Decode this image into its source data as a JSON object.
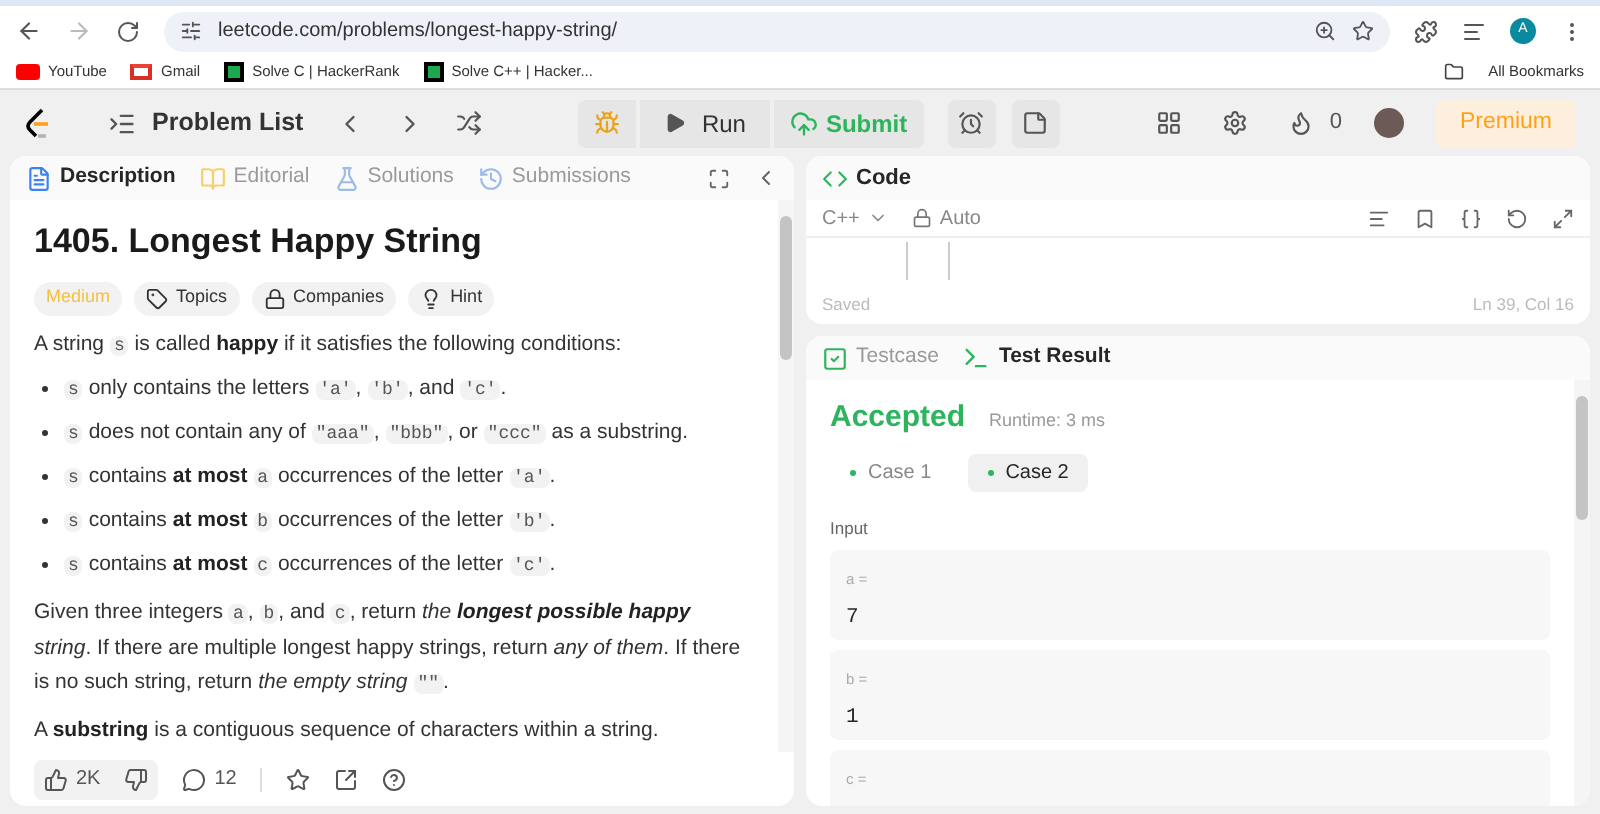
{
  "browser": {
    "url": "leetcode.com/problems/longest-happy-string/",
    "profile": "A",
    "bookmarks": [
      {
        "label": "YouTube",
        "kind": "youtube"
      },
      {
        "label": "Gmail",
        "kind": "gmail"
      },
      {
        "label": "Solve C | HackerRank",
        "kind": "hackerrank"
      },
      {
        "label": "Solve C++ | Hacker...",
        "kind": "hackerrank"
      }
    ],
    "all_bookmarks": "All Bookmarks"
  },
  "nav": {
    "problem_list": "Problem List",
    "run": "Run",
    "submit": "Submit",
    "streak": "0",
    "premium": "Premium"
  },
  "description_panel": {
    "tabs": [
      {
        "label": "Description",
        "selected": true,
        "kind": "description"
      },
      {
        "label": "Editorial",
        "selected": false,
        "kind": "editorial"
      },
      {
        "label": "Solutions",
        "selected": false,
        "kind": "solutions"
      },
      {
        "label": "Submissions",
        "selected": false,
        "kind": "submissions"
      }
    ],
    "title": "1405. Longest Happy String",
    "tags": [
      {
        "label": "Medium",
        "kind": "difficulty"
      },
      {
        "label": "Topics",
        "kind": "topics"
      },
      {
        "label": "Companies",
        "kind": "companies"
      },
      {
        "label": "Hint",
        "kind": "hint"
      }
    ],
    "blocks": [
      {
        "kind": "paragraph",
        "segments": [
          {
            "kind": "text",
            "text": "A string "
          },
          {
            "kind": "code",
            "text": "s"
          },
          {
            "kind": "text",
            "text": " is called "
          },
          {
            "kind": "bold",
            "text": "happy"
          },
          {
            "kind": "text",
            "text": " if it satisfies the following conditions:"
          }
        ]
      },
      {
        "kind": "bullet",
        "segments": [
          {
            "kind": "code",
            "text": "s"
          },
          {
            "kind": "text",
            "text": " only contains the letters "
          },
          {
            "kind": "code",
            "text": "'a'"
          },
          {
            "kind": "text",
            "text": ", "
          },
          {
            "kind": "code",
            "text": "'b'"
          },
          {
            "kind": "text",
            "text": ", and "
          },
          {
            "kind": "code",
            "text": "'c'"
          },
          {
            "kind": "text",
            "text": "."
          }
        ]
      },
      {
        "kind": "bullet",
        "segments": [
          {
            "kind": "code",
            "text": "s"
          },
          {
            "kind": "text",
            "text": " does not contain any of "
          },
          {
            "kind": "code",
            "text": "\"aaa\""
          },
          {
            "kind": "text",
            "text": ", "
          },
          {
            "kind": "code",
            "text": "\"bbb\""
          },
          {
            "kind": "text",
            "text": ", or "
          },
          {
            "kind": "code",
            "text": "\"ccc\""
          },
          {
            "kind": "text",
            "text": " as a substring."
          }
        ]
      },
      {
        "kind": "bullet",
        "segments": [
          {
            "kind": "code",
            "text": "s"
          },
          {
            "kind": "text",
            "text": " contains "
          },
          {
            "kind": "bold",
            "text": "at most "
          },
          {
            "kind": "code",
            "text": "a"
          },
          {
            "kind": "text",
            "text": " occurrences of the letter "
          },
          {
            "kind": "code",
            "text": "'a'"
          },
          {
            "kind": "text",
            "text": "."
          }
        ]
      },
      {
        "kind": "bullet",
        "segments": [
          {
            "kind": "code",
            "text": "s"
          },
          {
            "kind": "text",
            "text": " contains "
          },
          {
            "kind": "bold",
            "text": "at most "
          },
          {
            "kind": "code",
            "text": "b"
          },
          {
            "kind": "text",
            "text": " occurrences of the letter "
          },
          {
            "kind": "code",
            "text": "'b'"
          },
          {
            "kind": "text",
            "text": "."
          }
        ]
      },
      {
        "kind": "bullet",
        "segments": [
          {
            "kind": "code",
            "text": "s"
          },
          {
            "kind": "text",
            "text": " contains "
          },
          {
            "kind": "bold",
            "text": "at most "
          },
          {
            "kind": "code",
            "text": "c"
          },
          {
            "kind": "text",
            "text": " occurrences of the letter "
          },
          {
            "kind": "code",
            "text": "'c'"
          },
          {
            "kind": "text",
            "text": "."
          }
        ]
      },
      {
        "kind": "paragraph",
        "segments": [
          {
            "kind": "text",
            "text": "Given three integers "
          },
          {
            "kind": "code",
            "text": "a"
          },
          {
            "kind": "text",
            "text": ", "
          },
          {
            "kind": "code",
            "text": "b"
          },
          {
            "kind": "text",
            "text": ", and "
          },
          {
            "kind": "code",
            "text": "c"
          },
          {
            "kind": "text",
            "text": ", return "
          },
          {
            "kind": "italic",
            "text": "the "
          },
          {
            "kind": "bolditalic",
            "text": "longest possible happy"
          },
          {
            "kind": "italic",
            "text": " string"
          },
          {
            "kind": "text",
            "text": ". If there are multiple longest happy strings, return "
          },
          {
            "kind": "italic",
            "text": "any of them"
          },
          {
            "kind": "text",
            "text": ". If there is no such string, return "
          },
          {
            "kind": "italic",
            "text": "the empty string "
          },
          {
            "kind": "code",
            "text": "\"\""
          },
          {
            "kind": "text",
            "text": "."
          }
        ]
      },
      {
        "kind": "paragraph",
        "segments": [
          {
            "kind": "text",
            "text": "A "
          },
          {
            "kind": "bold",
            "text": "substring"
          },
          {
            "kind": "text",
            "text": " is a contiguous sequence of characters within a string."
          }
        ]
      }
    ],
    "likes": "2K",
    "comments": "12"
  },
  "code_panel": {
    "title": "Code",
    "language": "C++",
    "mode": "Auto",
    "status": "Saved",
    "cursor": "Ln 39, Col 16"
  },
  "result_panel": {
    "tabs": [
      {
        "label": "Testcase",
        "selected": false,
        "kind": "testcase"
      },
      {
        "label": "Test Result",
        "selected": true,
        "kind": "result"
      }
    ],
    "verdict": "Accepted",
    "runtime": "Runtime: 3 ms",
    "cases": [
      {
        "label": "Case 1",
        "selected": false
      },
      {
        "label": "Case 2",
        "selected": true
      }
    ],
    "input_label": "Input",
    "inputs": [
      {
        "name": "a =",
        "value": "7"
      },
      {
        "name": "b =",
        "value": "1"
      },
      {
        "name": "c ="
      }
    ]
  }
}
